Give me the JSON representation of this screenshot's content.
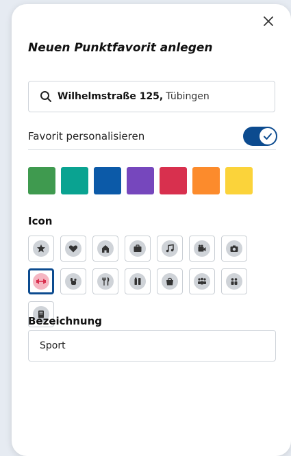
{
  "dialog": {
    "title": "Neuen Punktfavorit anlegen",
    "close_icon": "close-icon"
  },
  "search": {
    "street": "Wilhelmstraße 125,",
    "city": "Tübingen",
    "icon": "search-icon"
  },
  "personalize": {
    "label": "Favorit personalisieren",
    "enabled": true
  },
  "colors": [
    {
      "name": "green",
      "hex": "#3f9a4f"
    },
    {
      "name": "teal",
      "hex": "#0aa391"
    },
    {
      "name": "blue",
      "hex": "#0c5aa8"
    },
    {
      "name": "purple",
      "hex": "#7647bd"
    },
    {
      "name": "red",
      "hex": "#d8304e"
    },
    {
      "name": "orange",
      "hex": "#fc8b2c"
    },
    {
      "name": "yellow",
      "hex": "#fbd33a"
    }
  ],
  "icon_section": {
    "label": "Icon",
    "icons": [
      "star-icon",
      "heart-icon",
      "home-icon",
      "briefcase-icon",
      "music-icon",
      "video-camera-icon",
      "camera-icon",
      "dumbbell-icon",
      "pet-icon",
      "restaurant-icon",
      "drink-icon",
      "shopping-bag-icon",
      "group-icon",
      "family-icon",
      "book-icon"
    ],
    "selected": "dumbbell-icon"
  },
  "name_field": {
    "label": "Bezeichnung",
    "value": "Sport"
  },
  "theme": {
    "accent": "#0c4b8f",
    "selected_icon_bg": "#f5b6c2"
  }
}
